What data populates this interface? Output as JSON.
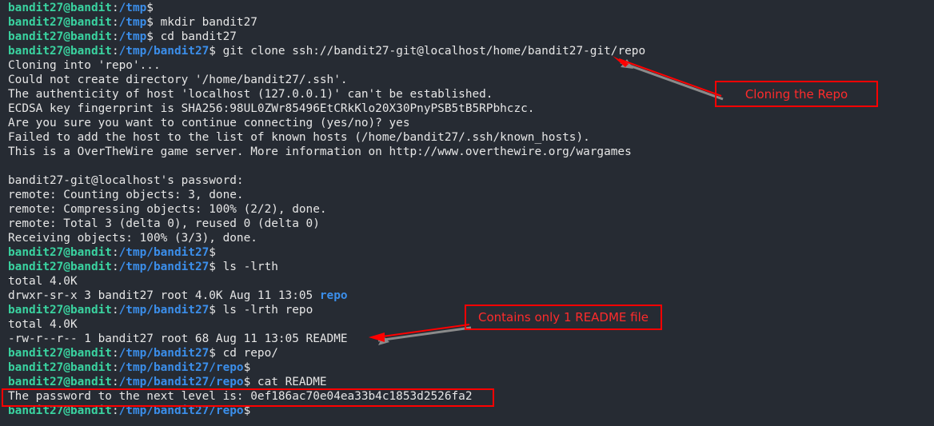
{
  "terminal": {
    "background_color": "#262b33",
    "foreground_color": "#e6e6e6",
    "prompt_user_color": "#3ad3a0",
    "prompt_path_color": "#3b8eea",
    "user_host": "bandit27@bandit",
    "lines": [
      {
        "type": "prompt",
        "path": "/tmp",
        "command": ""
      },
      {
        "type": "prompt",
        "path": "/tmp",
        "command": " mkdir bandit27"
      },
      {
        "type": "prompt",
        "path": "/tmp",
        "command": " cd bandit27"
      },
      {
        "type": "prompt",
        "path": "/tmp/bandit27",
        "command": " git clone ssh://bandit27-git@localhost/home/bandit27-git/repo"
      },
      {
        "type": "output",
        "text": "Cloning into 'repo'..."
      },
      {
        "type": "output",
        "text": "Could not create directory '/home/bandit27/.ssh'."
      },
      {
        "type": "output",
        "text": "The authenticity of host 'localhost (127.0.0.1)' can't be established."
      },
      {
        "type": "output",
        "text": "ECDSA key fingerprint is SHA256:98UL0ZWr85496EtCRkKlo20X30PnyPSB5tB5RPbhczc."
      },
      {
        "type": "output",
        "text": "Are you sure you want to continue connecting (yes/no)? yes"
      },
      {
        "type": "output",
        "text": "Failed to add the host to the list of known hosts (/home/bandit27/.ssh/known_hosts)."
      },
      {
        "type": "output",
        "text": "This is a OverTheWire game server. More information on http://www.overthewire.org/wargames"
      },
      {
        "type": "output",
        "text": ""
      },
      {
        "type": "output",
        "text": "bandit27-git@localhost's password:"
      },
      {
        "type": "output",
        "text": "remote: Counting objects: 3, done."
      },
      {
        "type": "output",
        "text": "remote: Compressing objects: 100% (2/2), done."
      },
      {
        "type": "output",
        "text": "remote: Total 3 (delta 0), reused 0 (delta 0)"
      },
      {
        "type": "output",
        "text": "Receiving objects: 100% (3/3), done."
      },
      {
        "type": "prompt",
        "path": "/tmp/bandit27",
        "command": ""
      },
      {
        "type": "prompt",
        "path": "/tmp/bandit27",
        "command": " ls -lrth"
      },
      {
        "type": "output",
        "text": "total 4.0K"
      },
      {
        "type": "listing",
        "prefix": "drwxr-sr-x 3 bandit27 root 4.0K Aug 11 13:05 ",
        "name": "repo"
      },
      {
        "type": "prompt",
        "path": "/tmp/bandit27",
        "command": " ls -lrth repo"
      },
      {
        "type": "output",
        "text": "total 4.0K"
      },
      {
        "type": "output",
        "text": "-rw-r--r-- 1 bandit27 root 68 Aug 11 13:05 README"
      },
      {
        "type": "prompt",
        "path": "/tmp/bandit27",
        "command": " cd repo/"
      },
      {
        "type": "prompt",
        "path": "/tmp/bandit27/repo",
        "command": ""
      },
      {
        "type": "prompt",
        "path": "/tmp/bandit27/repo",
        "command": " cat README"
      },
      {
        "type": "output",
        "text": "The password to the next level is: 0ef186ac70e04ea33b4c1853d2526fa2"
      },
      {
        "type": "prompt",
        "path": "/tmp/bandit27/repo",
        "command": ""
      }
    ]
  },
  "annotations": {
    "color": "#ff0000",
    "clone_label": "Cloning the Repo",
    "readme_label": "Contains only 1 README file",
    "password_highlight": "0ef186ac70e04ea33b4c1853d2526fa2"
  }
}
